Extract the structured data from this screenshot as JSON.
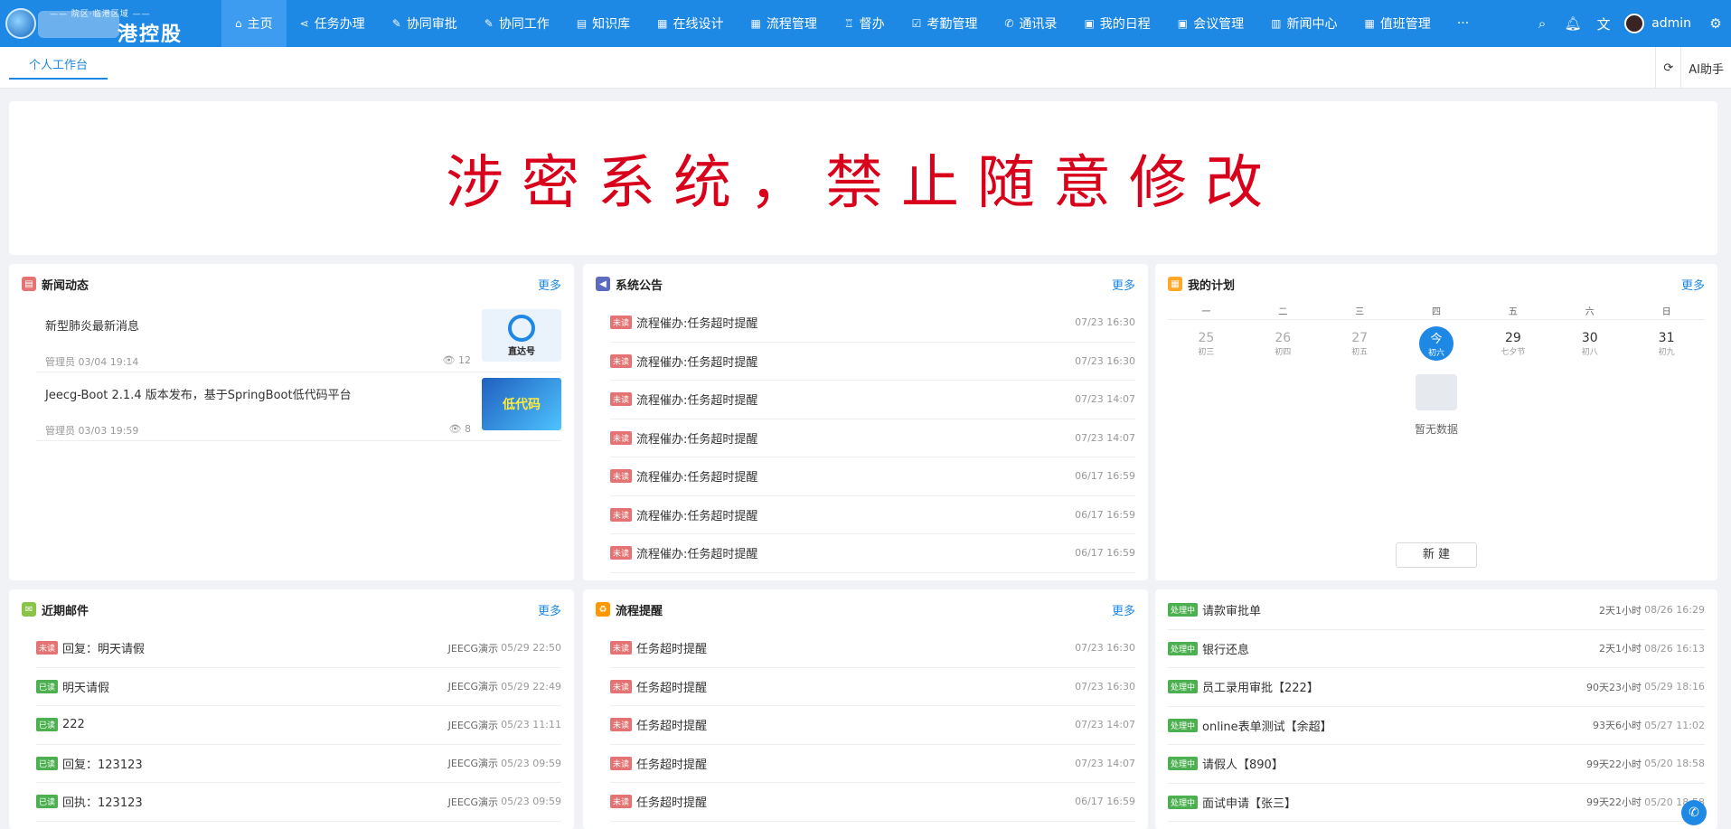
{
  "logo": {
    "subtitle": "—— 院区·临港区域 ——",
    "name": "港控股"
  },
  "nav": [
    {
      "icon": "⌂",
      "label": "主页",
      "active": true
    },
    {
      "icon": "⋖",
      "label": "任务办理"
    },
    {
      "icon": "✎",
      "label": "协同审批"
    },
    {
      "icon": "✎",
      "label": "协同工作"
    },
    {
      "icon": "▤",
      "label": "知识库"
    },
    {
      "icon": "▦",
      "label": "在线设计"
    },
    {
      "icon": "▦",
      "label": "流程管理"
    },
    {
      "icon": "♖",
      "label": "督办"
    },
    {
      "icon": "☑",
      "label": "考勤管理"
    },
    {
      "icon": "✆",
      "label": "通讯录"
    },
    {
      "icon": "▣",
      "label": "我的日程"
    },
    {
      "icon": "▣",
      "label": "会议管理"
    },
    {
      "icon": "▥",
      "label": "新闻中心"
    },
    {
      "icon": "▦",
      "label": "值班管理"
    }
  ],
  "nav_more": "···",
  "user": {
    "name": "admin"
  },
  "tabs": {
    "active": "个人工作台",
    "tool_refresh": "⟳",
    "tool_ai": "AI助手"
  },
  "banner": "涉密系统，禁止随意修改",
  "news": {
    "title": "新闻动态",
    "more": "更多",
    "items": [
      {
        "title": "新型肺炎最新消息",
        "meta": "管理员 03/04 19:14",
        "views": "12",
        "thumb_text": "直达号"
      },
      {
        "title": "Jeecg-Boot 2.1.4 版本发布，基于SpringBoot低代码平台",
        "meta": "管理员 03/03 19:59",
        "views": "8",
        "thumb_text": "低代码"
      }
    ]
  },
  "notice": {
    "title": "系统公告",
    "more": "更多",
    "items": [
      {
        "tag": "未读",
        "title": "流程催办:任务超时提醒",
        "date": "07/23 16:30"
      },
      {
        "tag": "未读",
        "title": "流程催办:任务超时提醒",
        "date": "07/23 16:30"
      },
      {
        "tag": "未读",
        "title": "流程催办:任务超时提醒",
        "date": "07/23 14:07"
      },
      {
        "tag": "未读",
        "title": "流程催办:任务超时提醒",
        "date": "07/23 14:07"
      },
      {
        "tag": "未读",
        "title": "流程催办:任务超时提醒",
        "date": "06/17 16:59"
      },
      {
        "tag": "未读",
        "title": "流程催办:任务超时提醒",
        "date": "06/17 16:59"
      },
      {
        "tag": "未读",
        "title": "流程催办:任务超时提醒",
        "date": "06/17 16:59"
      }
    ]
  },
  "plan": {
    "title": "我的计划",
    "more": "更多",
    "weekdays": [
      "一",
      "二",
      "三",
      "四",
      "五",
      "六",
      "日"
    ],
    "days": [
      {
        "n": "25",
        "l": "初三"
      },
      {
        "n": "26",
        "l": "初四"
      },
      {
        "n": "27",
        "l": "初五"
      },
      {
        "n": "今",
        "l": "初六"
      },
      {
        "n": "29",
        "l": "七夕节"
      },
      {
        "n": "30",
        "l": "初八"
      },
      {
        "n": "31",
        "l": "初九"
      }
    ],
    "empty": "暂无数据",
    "new_button": "新 建"
  },
  "mail": {
    "title": "近期邮件",
    "more": "更多",
    "items": [
      {
        "tag": "未读",
        "unread": true,
        "title": "回复：明天请假",
        "who": "JEECG演示",
        "date": "05/29 22:50"
      },
      {
        "tag": "已读",
        "unread": false,
        "title": "明天请假",
        "who": "JEECG演示",
        "date": "05/29 22:49"
      },
      {
        "tag": "已读",
        "unread": false,
        "title": "222",
        "who": "JEECG演示",
        "date": "05/23 11:11"
      },
      {
        "tag": "已读",
        "unread": false,
        "title": "回复：123123",
        "who": "JEECG演示",
        "date": "05/23 09:59"
      },
      {
        "tag": "已读",
        "unread": false,
        "title": "回执：123123",
        "who": "JEECG演示",
        "date": "05/23 09:59"
      }
    ]
  },
  "flow": {
    "title": "流程提醒",
    "more": "更多",
    "items": [
      {
        "tag": "未读",
        "title": "任务超时提醒",
        "date": "07/23 16:30"
      },
      {
        "tag": "未读",
        "title": "任务超时提醒",
        "date": "07/23 16:30"
      },
      {
        "tag": "未读",
        "title": "任务超时提醒",
        "date": "07/23 14:07"
      },
      {
        "tag": "未读",
        "title": "任务超时提醒",
        "date": "07/23 14:07"
      },
      {
        "tag": "未读",
        "title": "任务超时提醒",
        "date": "06/17 16:59"
      }
    ]
  },
  "process": {
    "items": [
      {
        "tag": "处理中",
        "title": "请款审批单",
        "dur": "2天1小时",
        "date": "08/26 16:29"
      },
      {
        "tag": "处理中",
        "title": "银行还息",
        "dur": "2天1小时",
        "date": "08/26 16:13"
      },
      {
        "tag": "处理中",
        "title": "员工录用审批【222】",
        "dur": "90天23小时",
        "date": "05/29 18:16"
      },
      {
        "tag": "处理中",
        "title": "online表单测试【余超】",
        "dur": "93天6小时",
        "date": "05/27 11:02"
      },
      {
        "tag": "处理中",
        "title": "请假人【890】",
        "dur": "99天22小时",
        "date": "05/20 18:58"
      },
      {
        "tag": "处理中",
        "title": "面试申请【张三】",
        "dur": "99天22小时",
        "date": "05/20 18:58"
      }
    ]
  }
}
